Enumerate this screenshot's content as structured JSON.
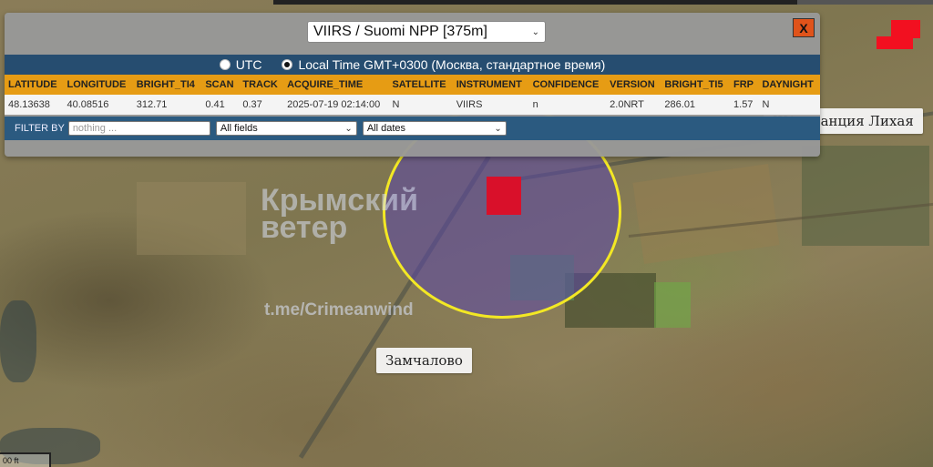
{
  "popup": {
    "source_select": "VIIRS / Suomi NPP [375m]",
    "close_label": "X",
    "time_options": [
      {
        "label": "UTC",
        "selected": false
      },
      {
        "label": "Local Time GMT+0300 (Москва, стандартное время)",
        "selected": true
      }
    ],
    "table": {
      "headers": [
        "LATITUDE",
        "LONGITUDE",
        "BRIGHT_TI4",
        "SCAN",
        "TRACK",
        "ACQUIRE_TIME",
        "SATELLITE",
        "INSTRUMENT",
        "CONFIDENCE",
        "VERSION",
        "BRIGHT_TI5",
        "FRP",
        "DAYNIGHT"
      ],
      "rows": [
        [
          "48.13638",
          "40.08516",
          "312.71",
          "0.41",
          "0.37",
          "2025-07-19 02:14:00",
          "N",
          "VIIRS",
          "n",
          "2.0NRT",
          "286.01",
          "1.57",
          "N"
        ]
      ]
    },
    "filter": {
      "label": "FILTER BY",
      "input_placeholder": "nothing ...",
      "fields_select": "All fields",
      "dates_select": "All dates"
    }
  },
  "map": {
    "labels": {
      "station": "Ж/д станция Лихая",
      "village": "Замчалово"
    },
    "watermark": {
      "line1": "Крымский",
      "line2": "ветер",
      "channel": "t.me/Crimeanwind"
    },
    "scale_text": "00 ft",
    "colors": {
      "hotspot": "#d9102a",
      "circle_ring": "#f3e824",
      "table_header": "#e69c14",
      "bar_blue": "#264d70"
    }
  }
}
